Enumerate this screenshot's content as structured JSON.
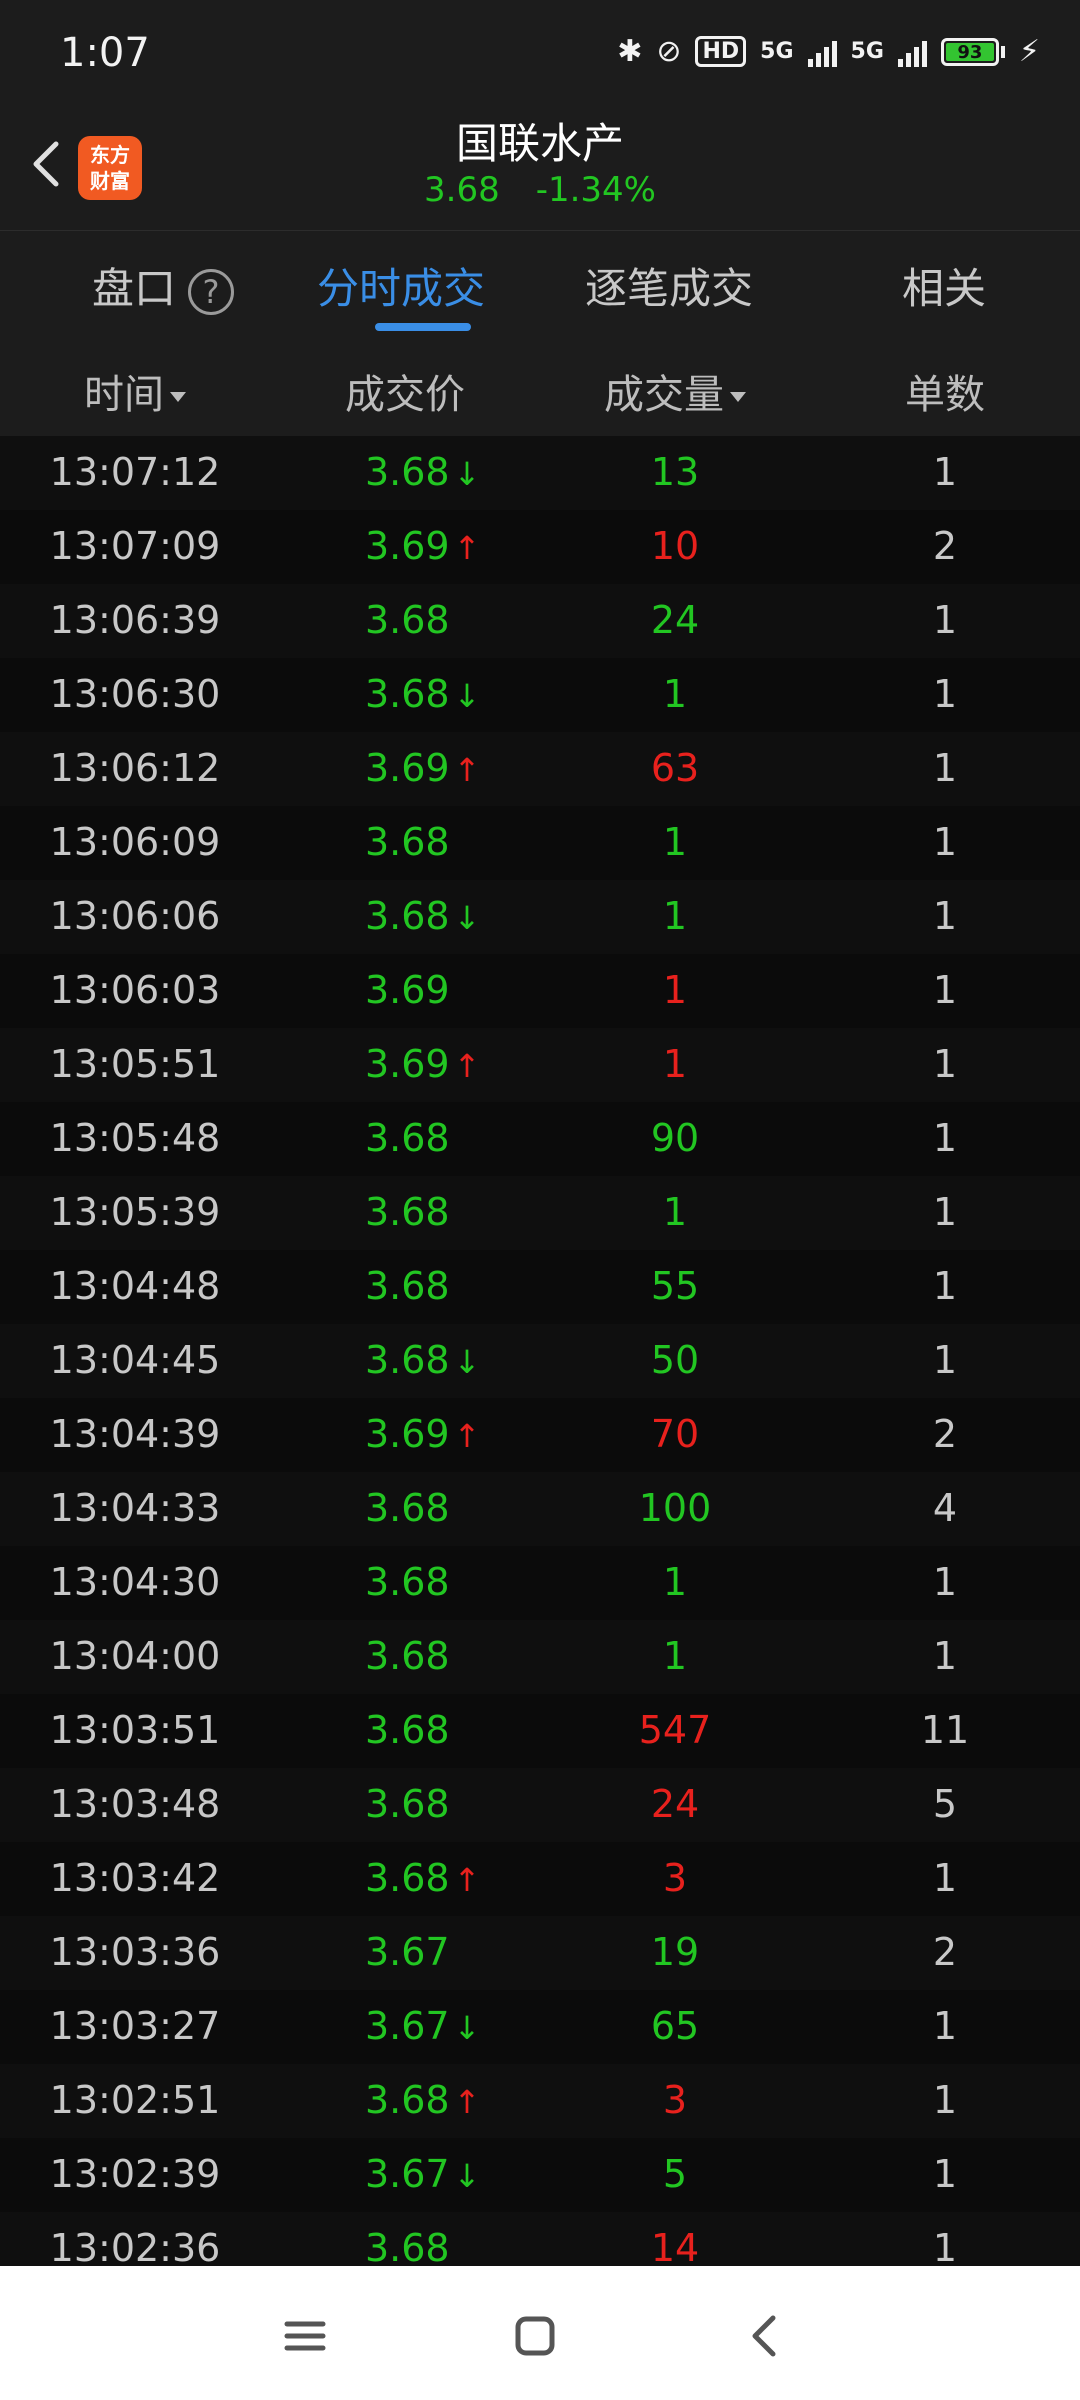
{
  "status_bar": {
    "time": "1:07",
    "hd": "HD",
    "net1": "5G",
    "net2": "5G",
    "battery": "93"
  },
  "header": {
    "stock_name": "国联水产",
    "price": "3.68",
    "change": "-1.34%",
    "logo_line1": "东方",
    "logo_line2": "财富"
  },
  "tabs": [
    {
      "label": "盘口",
      "active": false
    },
    {
      "label": "分时成交",
      "active": true
    },
    {
      "label": "逐笔成交",
      "active": false
    },
    {
      "label": "相关",
      "active": false
    }
  ],
  "columns": {
    "time": "时间",
    "price": "成交价",
    "volume": "成交量",
    "count": "单数"
  },
  "colors": {
    "up": "#e8211d",
    "down": "#22c622",
    "accent": "#3a8ee6"
  },
  "trades": [
    {
      "time": "13:07:12",
      "price": "3.68",
      "dir": "down",
      "volume": "13",
      "vol_color": "green",
      "count": "1"
    },
    {
      "time": "13:07:09",
      "price": "3.69",
      "dir": "up",
      "volume": "10",
      "vol_color": "red",
      "count": "2"
    },
    {
      "time": "13:06:39",
      "price": "3.68",
      "dir": "",
      "volume": "24",
      "vol_color": "green",
      "count": "1"
    },
    {
      "time": "13:06:30",
      "price": "3.68",
      "dir": "down",
      "volume": "1",
      "vol_color": "green",
      "count": "1"
    },
    {
      "time": "13:06:12",
      "price": "3.69",
      "dir": "up",
      "volume": "63",
      "vol_color": "red",
      "count": "1"
    },
    {
      "time": "13:06:09",
      "price": "3.68",
      "dir": "",
      "volume": "1",
      "vol_color": "green",
      "count": "1"
    },
    {
      "time": "13:06:06",
      "price": "3.68",
      "dir": "down",
      "volume": "1",
      "vol_color": "green",
      "count": "1"
    },
    {
      "time": "13:06:03",
      "price": "3.69",
      "dir": "",
      "volume": "1",
      "vol_color": "red",
      "count": "1"
    },
    {
      "time": "13:05:51",
      "price": "3.69",
      "dir": "up",
      "volume": "1",
      "vol_color": "red",
      "count": "1"
    },
    {
      "time": "13:05:48",
      "price": "3.68",
      "dir": "",
      "volume": "90",
      "vol_color": "green",
      "count": "1"
    },
    {
      "time": "13:05:39",
      "price": "3.68",
      "dir": "",
      "volume": "1",
      "vol_color": "green",
      "count": "1"
    },
    {
      "time": "13:04:48",
      "price": "3.68",
      "dir": "",
      "volume": "55",
      "vol_color": "green",
      "count": "1"
    },
    {
      "time": "13:04:45",
      "price": "3.68",
      "dir": "down",
      "volume": "50",
      "vol_color": "green",
      "count": "1"
    },
    {
      "time": "13:04:39",
      "price": "3.69",
      "dir": "up",
      "volume": "70",
      "vol_color": "red",
      "count": "2"
    },
    {
      "time": "13:04:33",
      "price": "3.68",
      "dir": "",
      "volume": "100",
      "vol_color": "green",
      "count": "4"
    },
    {
      "time": "13:04:30",
      "price": "3.68",
      "dir": "",
      "volume": "1",
      "vol_color": "green",
      "count": "1"
    },
    {
      "time": "13:04:00",
      "price": "3.68",
      "dir": "",
      "volume": "1",
      "vol_color": "green",
      "count": "1"
    },
    {
      "time": "13:03:51",
      "price": "3.68",
      "dir": "",
      "volume": "547",
      "vol_color": "red",
      "count": "11"
    },
    {
      "time": "13:03:48",
      "price": "3.68",
      "dir": "",
      "volume": "24",
      "vol_color": "red",
      "count": "5"
    },
    {
      "time": "13:03:42",
      "price": "3.68",
      "dir": "up",
      "volume": "3",
      "vol_color": "red",
      "count": "1"
    },
    {
      "time": "13:03:36",
      "price": "3.67",
      "dir": "",
      "volume": "19",
      "vol_color": "green",
      "count": "2"
    },
    {
      "time": "13:03:27",
      "price": "3.67",
      "dir": "down",
      "volume": "65",
      "vol_color": "green",
      "count": "1"
    },
    {
      "time": "13:02:51",
      "price": "3.68",
      "dir": "up",
      "volume": "3",
      "vol_color": "red",
      "count": "1"
    },
    {
      "time": "13:02:39",
      "price": "3.67",
      "dir": "down",
      "volume": "5",
      "vol_color": "green",
      "count": "1"
    },
    {
      "time": "13:02:36",
      "price": "3.68",
      "dir": "",
      "volume": "14",
      "vol_color": "red",
      "count": "1"
    }
  ]
}
